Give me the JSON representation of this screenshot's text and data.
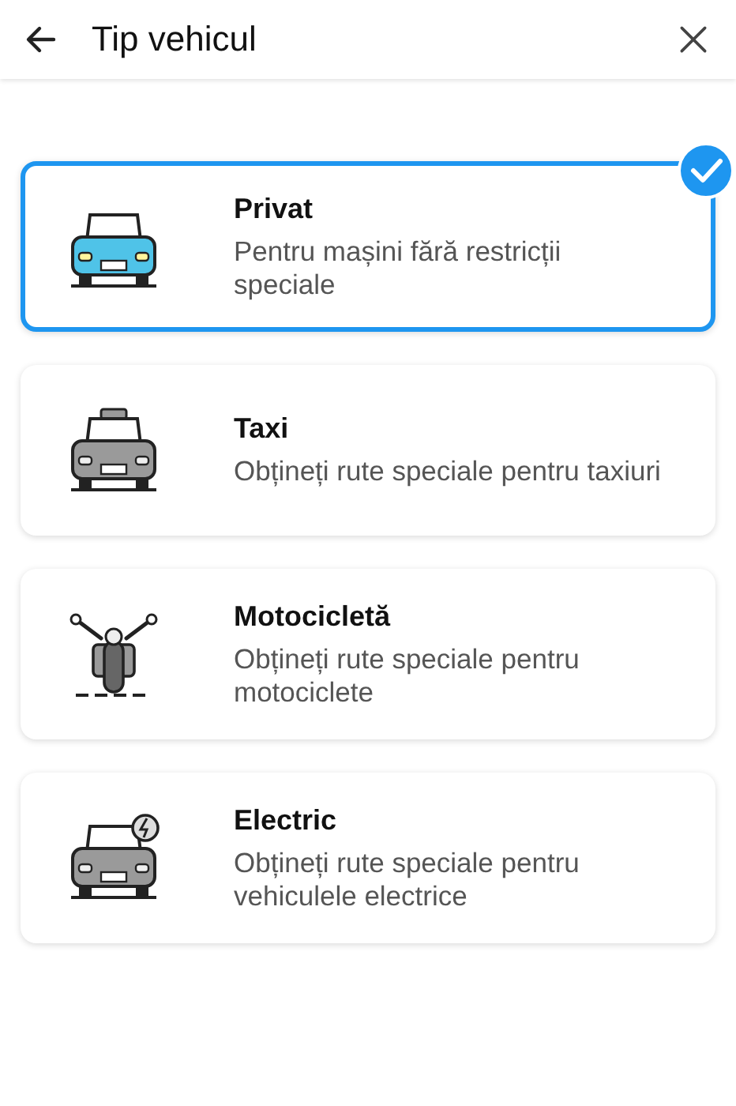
{
  "header": {
    "title": "Tip vehicul"
  },
  "options": [
    {
      "kind": "car",
      "title": "Privat",
      "description": "Pentru mașini fără restricții speciale",
      "selected": true
    },
    {
      "kind": "taxi",
      "title": "Taxi",
      "description": "Obțineți rute speciale pentru taxiuri",
      "selected": false
    },
    {
      "kind": "motorcycle",
      "title": "Motocicletă",
      "description": "Obțineți rute speciale pentru motociclete",
      "selected": false
    },
    {
      "kind": "electric",
      "title": "Electric",
      "description": "Obțineți rute speciale pentru vehiculele electrice",
      "selected": false
    }
  ]
}
